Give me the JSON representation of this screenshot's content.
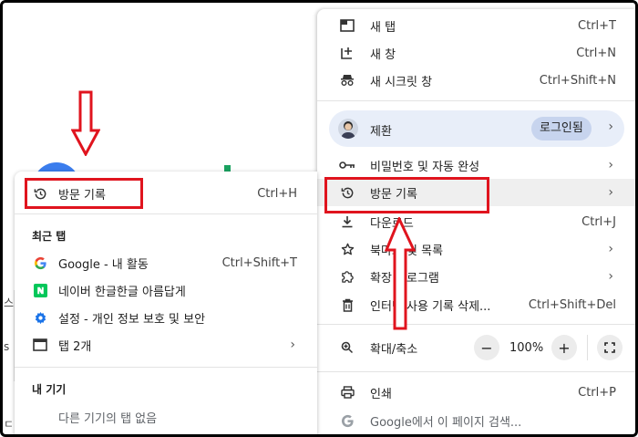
{
  "background": {
    "left_chars": [
      "스",
      "s",
      "ㅌ",
      "ㄷ"
    ]
  },
  "main_menu": {
    "new_tab": {
      "label": "새 탭",
      "shortcut": "Ctrl+T"
    },
    "new_window": {
      "label": "새 창",
      "shortcut": "Ctrl+N"
    },
    "incognito": {
      "label": "새 시크릿 창",
      "shortcut": "Ctrl+Shift+N"
    },
    "profile": {
      "name": "제환",
      "badge": "로그인됨"
    },
    "passwords": {
      "label": "비밀번호 및 자동 완성"
    },
    "history": {
      "label": "방문 기록"
    },
    "downloads": {
      "label": "다운로드",
      "shortcut": "Ctrl+J"
    },
    "bookmarks": {
      "label": "북마크 및 목록"
    },
    "extensions": {
      "label": "확장 프로그램"
    },
    "clear_data": {
      "label": "인터넷 사용 기록 삭제...",
      "shortcut": "Ctrl+Shift+Del"
    },
    "zoom": {
      "label": "확대/축소",
      "minus": "−",
      "value": "100%",
      "plus": "+"
    },
    "print": {
      "label": "인쇄",
      "shortcut": "Ctrl+P"
    },
    "find": {
      "label": "Google에서 이 페이지 검색..."
    }
  },
  "history_submenu": {
    "history": {
      "label": "방문 기록",
      "shortcut": "Ctrl+H"
    },
    "recent_tabs_title": "최근 탭",
    "recent": [
      {
        "label": "Google - 내 활동",
        "shortcut": "Ctrl+Shift+T"
      },
      {
        "label": "네이버 한글한글 아름답게"
      },
      {
        "label": "설정 - 개인 정보 보호 및 보안"
      },
      {
        "label": "탭 2개"
      }
    ],
    "devices_title": "내 기기",
    "no_tabs": "다른 기기의 탭 없음"
  },
  "colors": {
    "highlight": "#e0141e",
    "profile_bg": "#e8eef9",
    "badge_bg": "#c7d4ee"
  }
}
